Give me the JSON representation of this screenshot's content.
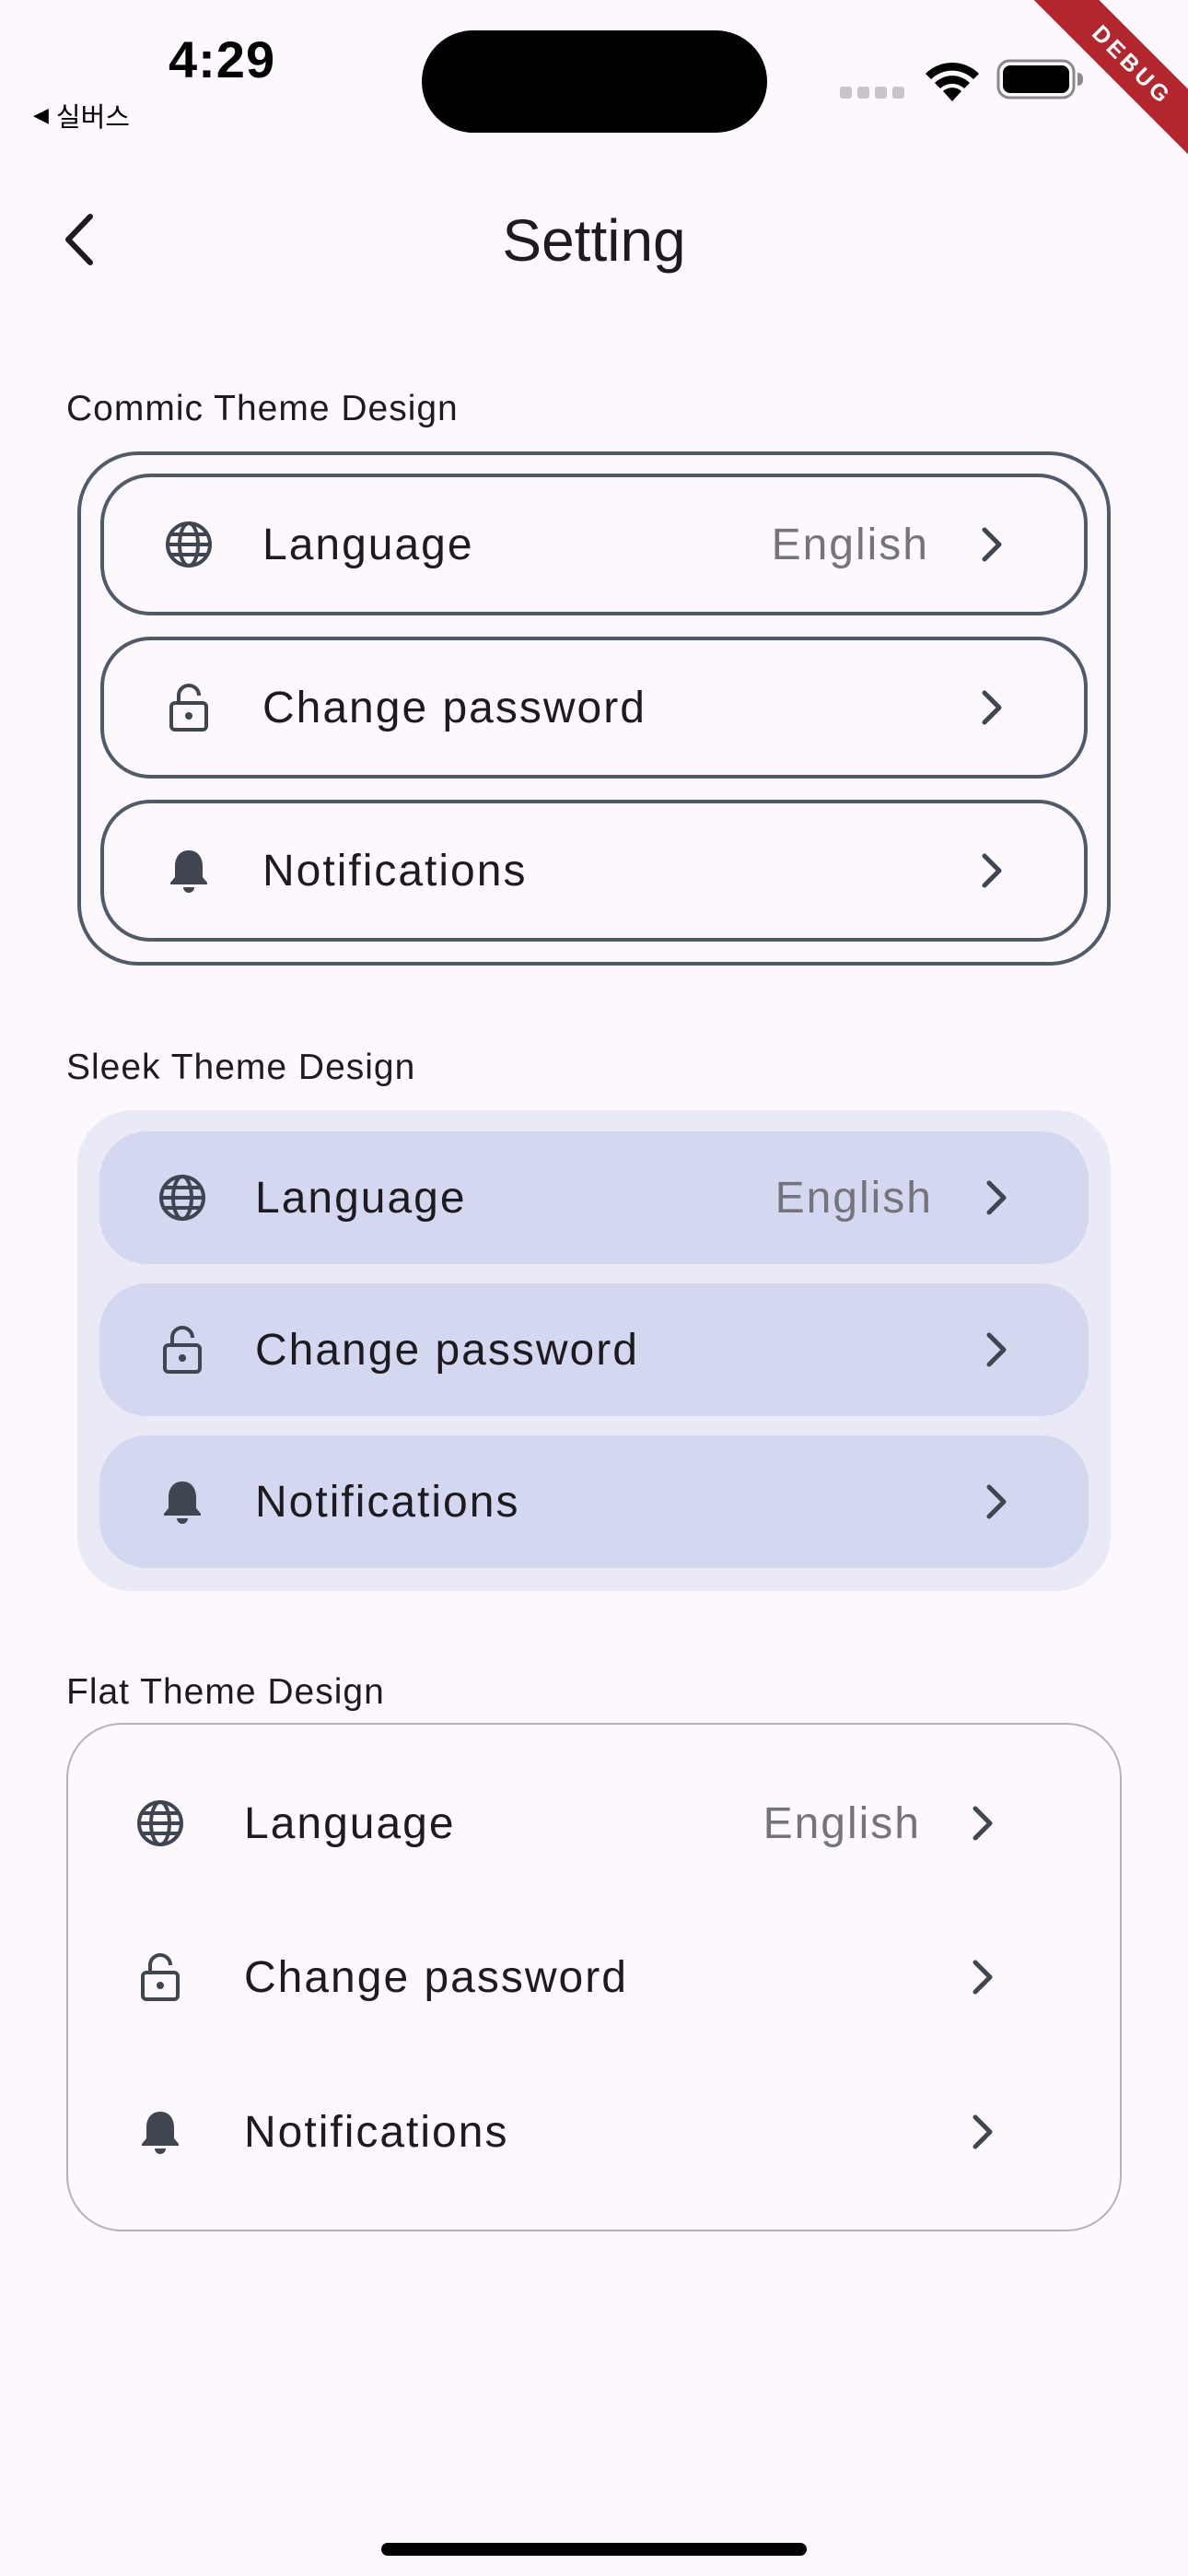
{
  "status_bar": {
    "time": "4:29",
    "back_app": "실버스",
    "back_triangle": "◀",
    "debug_banner": "DEBUG"
  },
  "app_bar": {
    "title": "Setting"
  },
  "sections": {
    "commic": {
      "title": "Commic Theme Design",
      "items": [
        {
          "icon": "globe-icon",
          "label": "Language",
          "value": "English"
        },
        {
          "icon": "lock-icon",
          "label": "Change password",
          "value": ""
        },
        {
          "icon": "bell-icon",
          "label": "Notifications",
          "value": ""
        }
      ]
    },
    "sleek": {
      "title": "Sleek Theme Design",
      "items": [
        {
          "icon": "globe-icon",
          "label": "Language",
          "value": "English"
        },
        {
          "icon": "lock-icon",
          "label": "Change password",
          "value": ""
        },
        {
          "icon": "bell-icon",
          "label": "Notifications",
          "value": ""
        }
      ]
    },
    "flat": {
      "title": "Flat Theme Design",
      "items": [
        {
          "icon": "globe-icon",
          "label": "Language",
          "value": "English"
        },
        {
          "icon": "lock-icon",
          "label": "Change password",
          "value": ""
        },
        {
          "icon": "bell-icon",
          "label": "Notifications",
          "value": ""
        }
      ]
    }
  },
  "colors": {
    "background": "#fdf8fd",
    "commic_border": "#4f5b6b",
    "sleek_container": "#e9eaf6",
    "sleek_item": "#d3d7ef",
    "flat_border": "#b5b3b8",
    "icon": "#3f4551",
    "secondary_text": "#76747b",
    "debug_ribbon": "#b3262d"
  }
}
